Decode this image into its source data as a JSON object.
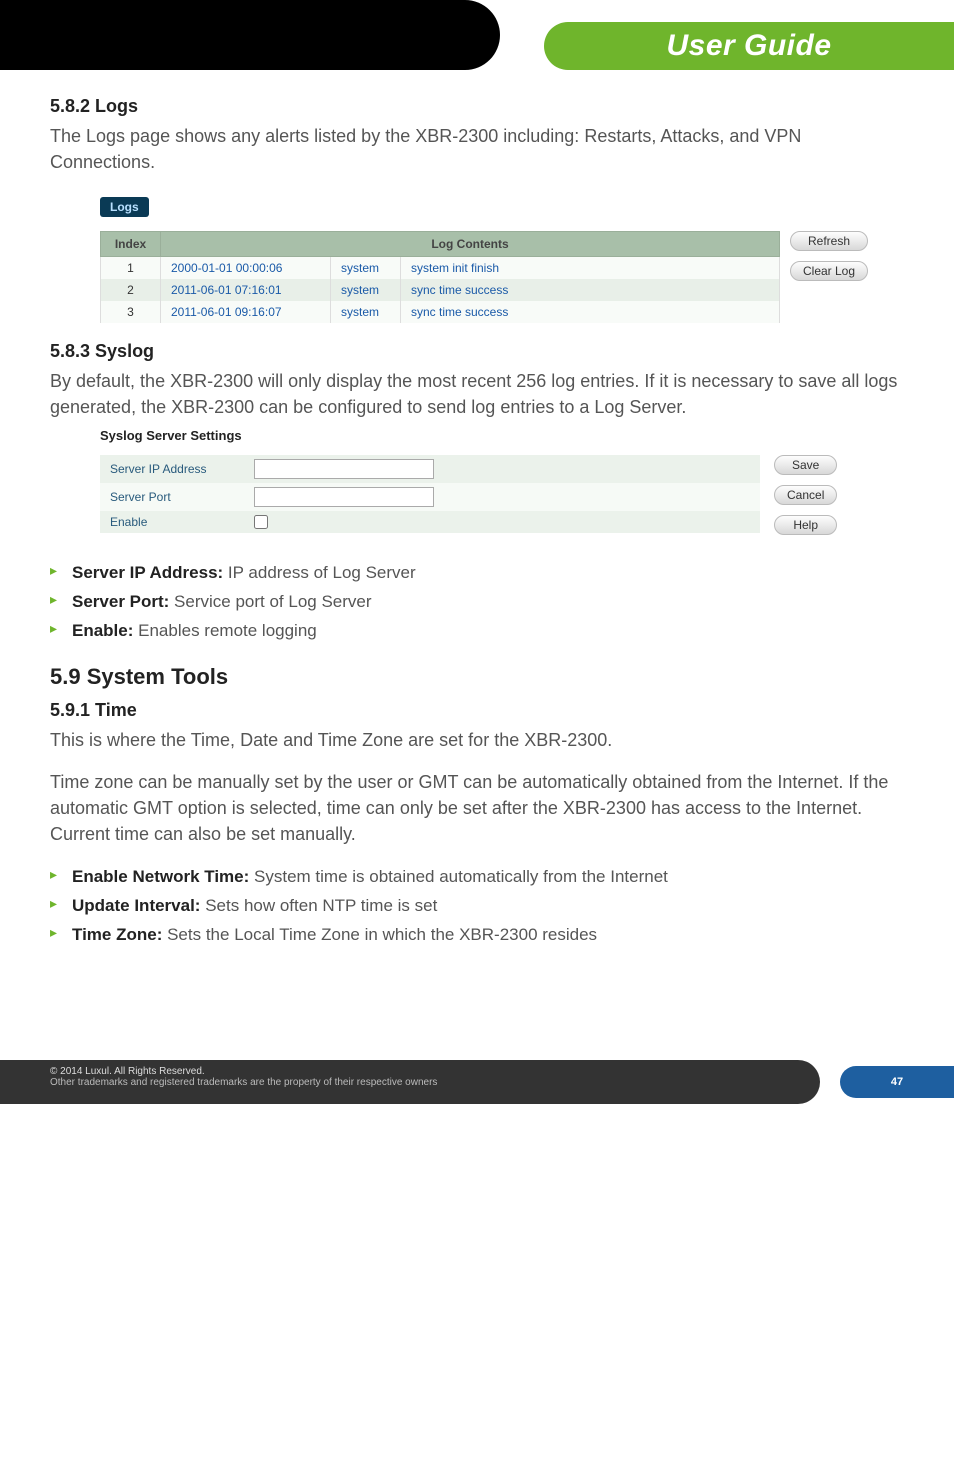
{
  "header": {
    "title": "User Guide"
  },
  "s582": {
    "heading": "5.8.2 Logs",
    "para": "The Logs page shows any alerts listed by the XBR-2300 including: Restarts, Attacks, and VPN Connections."
  },
  "logs_shot": {
    "tab": "Logs",
    "cols": {
      "index": "Index",
      "contents": "Log Contents"
    },
    "rows": [
      {
        "i": "1",
        "ts": "2000-01-01 00:00:06",
        "src": "system",
        "msg": "system init finish"
      },
      {
        "i": "2",
        "ts": "2011-06-01 07:16:01",
        "src": "system",
        "msg": "sync time success"
      },
      {
        "i": "3",
        "ts": "2011-06-01 09:16:07",
        "src": "system",
        "msg": "sync time success"
      }
    ],
    "buttons": {
      "refresh": "Refresh",
      "clear": "Clear Log"
    }
  },
  "s583": {
    "heading": "5.8.3 Syslog",
    "para": "By default, the XBR-2300 will only display the most recent 256 log entries. If it is necessary to save all logs generated, the XBR-2300 can be configured to send log entries to a Log Server."
  },
  "syslog_shot": {
    "title": "Syslog Server Settings",
    "labels": {
      "ip": "Server IP Address",
      "port": "Server Port",
      "enable": "Enable"
    },
    "values": {
      "ip": "",
      "port": ""
    },
    "buttons": {
      "save": "Save",
      "cancel": "Cancel",
      "help": "Help"
    }
  },
  "syslog_items": [
    {
      "k": "Server IP Address:",
      "v": " IP address of Log Server"
    },
    {
      "k": "Server Port:",
      "v": " Service port of Log Server"
    },
    {
      "k": "Enable:",
      "v": " Enables remote logging"
    }
  ],
  "s59": {
    "heading": "5.9 System Tools"
  },
  "s591": {
    "heading": "5.9.1 Time",
    "para1": "This is where the Time, Date and Time Zone are set for the XBR-2300.",
    "para2": "Time zone can be manually set by the user or GMT can be automatically obtained from the Internet. If the automatic GMT option is selected, time can only be set after the XBR-2300 has access to the Internet. Current time can also be set manually."
  },
  "time_items": [
    {
      "k": "Enable Network Time:",
      "v": " System time is obtained automatically from the Internet"
    },
    {
      "k": "Update Interval:",
      "v": " Sets how often NTP time is set"
    },
    {
      "k": "Time Zone:",
      "v": " Sets the Local Time Zone in which the XBR-2300 resides"
    }
  ],
  "footer": {
    "l1": "© 2014  Luxul. All Rights Reserved.",
    "l2": "Other trademarks and registered trademarks are the property of their respective owners",
    "page": "47"
  }
}
